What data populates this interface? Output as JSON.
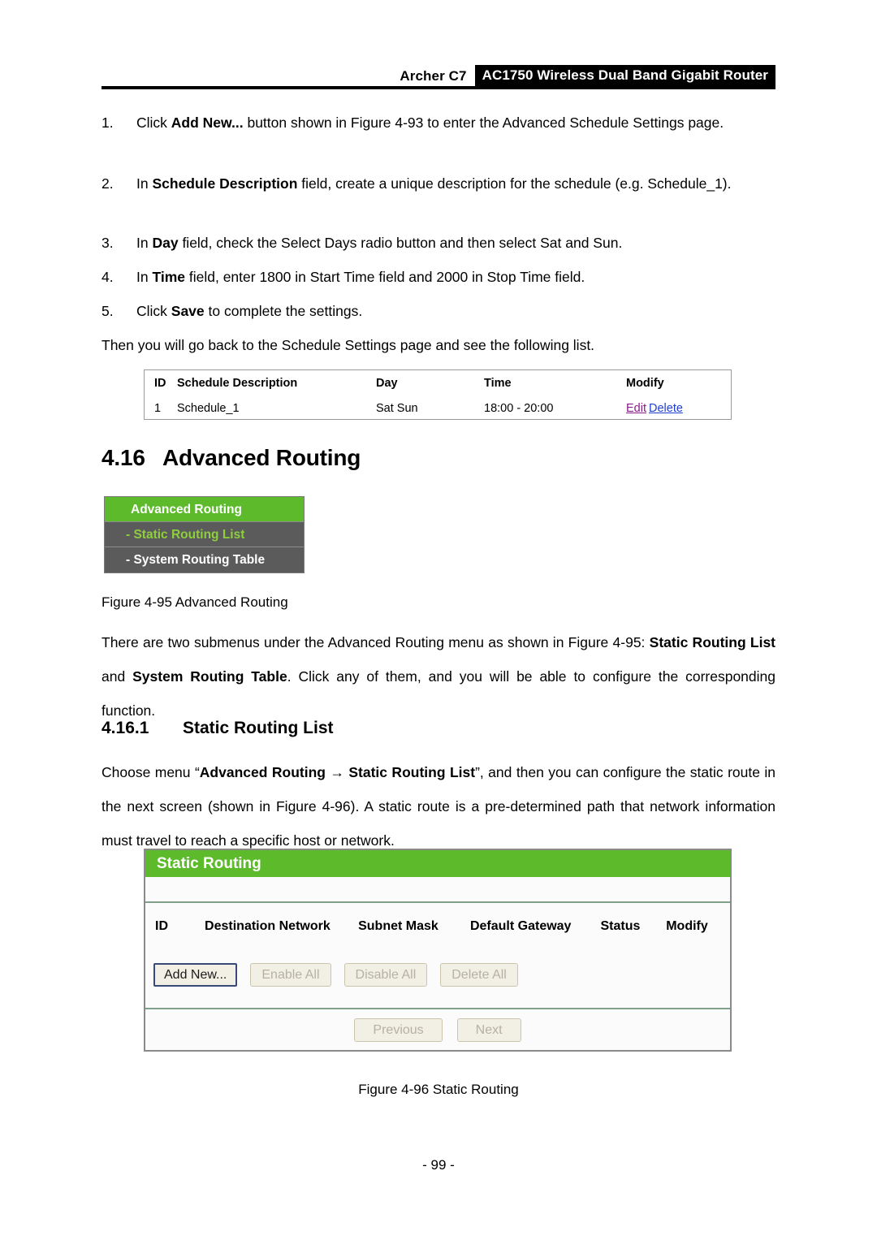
{
  "header": {
    "model": "Archer C7",
    "product": "AC1750 Wireless Dual Band Gigabit Router"
  },
  "steps": [
    {
      "num": "1.",
      "segments": [
        {
          "t": "Click ",
          "b": false
        },
        {
          "t": "Add New...",
          "b": true
        },
        {
          "t": " button shown in Figure 4-93 to enter the Advanced Schedule Settings page.",
          "b": false
        }
      ]
    },
    {
      "num": "2.",
      "segments": [
        {
          "t": "In ",
          "b": false
        },
        {
          "t": "Schedule Description",
          "b": true
        },
        {
          "t": " field, create a unique description for the schedule (e.g. Schedule_1).",
          "b": false
        }
      ]
    },
    {
      "num": "3.",
      "segments": [
        {
          "t": "In ",
          "b": false
        },
        {
          "t": "Day",
          "b": true
        },
        {
          "t": " field, check the Select Days radio button and then select Sat and Sun.",
          "b": false
        }
      ]
    },
    {
      "num": "4.",
      "segments": [
        {
          "t": "In ",
          "b": false
        },
        {
          "t": "Time",
          "b": true
        },
        {
          "t": " field, enter 1800 in Start Time field and 2000 in Stop Time field.",
          "b": false
        }
      ]
    },
    {
      "num": "5.",
      "segments": [
        {
          "t": "Click ",
          "b": false
        },
        {
          "t": "Save",
          "b": true
        },
        {
          "t": " to complete the settings.",
          "b": false
        }
      ]
    }
  ],
  "intro_paragraph": "Then you will go back to the Schedule Settings page and see the following list.",
  "schedule_table": {
    "columns": [
      "ID",
      "Schedule Description",
      "Day",
      "Time",
      "Modify"
    ],
    "rows": [
      {
        "id": "1",
        "description": "Schedule_1",
        "day": "Sat Sun",
        "time": "18:00 - 20:00",
        "edit_label": "Edit",
        "delete_label": "Delete"
      }
    ]
  },
  "section": {
    "number": "4.16",
    "title": "Advanced Routing"
  },
  "routing_menu": {
    "header_label": "Advanced Routing",
    "items": [
      {
        "label": "- Static Routing List",
        "active": true
      },
      {
        "label": "- System Routing Table",
        "active": false
      }
    ]
  },
  "figure95_caption": "Figure 4-95 Advanced Routing",
  "submenu_paragraph": {
    "segments": [
      {
        "t": "There are two submenus under the Advanced Routing menu as shown in Figure 4-95: ",
        "b": false
      },
      {
        "t": "Static Routing List",
        "b": true
      },
      {
        "t": " and ",
        "b": false
      },
      {
        "t": "System Routing Table",
        "b": true
      },
      {
        "t": ". Click any of them, and you will be able to configure the corresponding function.",
        "b": false
      }
    ]
  },
  "subsection": {
    "number": "4.16.1",
    "title": "Static Routing List"
  },
  "choose_menu_paragraph": {
    "segments": [
      {
        "t": "Choose menu “",
        "b": false
      },
      {
        "t": "Advanced Routing",
        "b": true
      },
      {
        "t": " → ",
        "b": true
      },
      {
        "t": "Static Routing List",
        "b": true
      },
      {
        "t": "”, and then you can configure the static route in the next screen (shown in Figure 4-96). A static route is a pre-determined path that network information must travel to reach a specific host or network.",
        "b": false
      }
    ]
  },
  "static_routing_panel": {
    "title": "Static Routing",
    "columns": [
      "ID",
      "Destination Network",
      "Subnet Mask",
      "Default Gateway",
      "Status",
      "Modify"
    ],
    "rows": [],
    "buttons": [
      {
        "label": "Add New...",
        "state": "active"
      },
      {
        "label": "Enable All",
        "state": "disabled"
      },
      {
        "label": "Disable All",
        "state": "disabled"
      },
      {
        "label": "Delete All",
        "state": "disabled"
      }
    ],
    "pager": [
      {
        "label": "Previous",
        "state": "disabled"
      },
      {
        "label": "Next",
        "state": "disabled"
      }
    ]
  },
  "figure96_caption": "Figure 4-96 Static Routing",
  "page_number": "- 99 -",
  "colors": {
    "brand_green": "#5cba2b",
    "menu_active_green": "#8ecf3e",
    "menu_gray": "#5b5b5b",
    "link_visited": "#8b1a8b",
    "link": "#1f3fd0",
    "button_face": "#f2f0e4",
    "button_focus_border": "#39497a"
  }
}
